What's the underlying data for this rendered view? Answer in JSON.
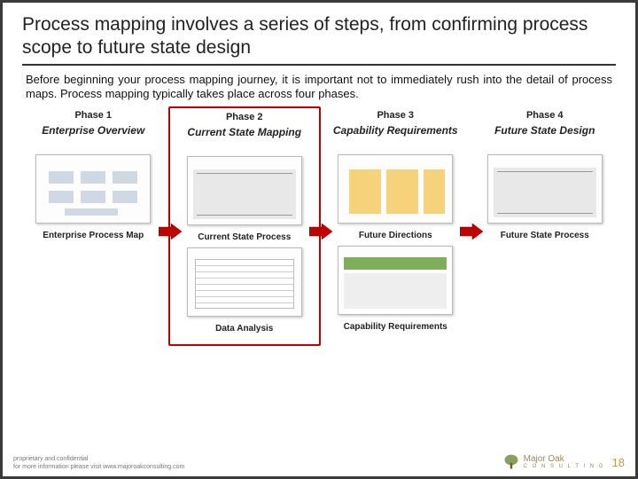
{
  "title": "Process mapping involves a series of steps, from confirming process scope to future state design",
  "intro": "Before beginning your process mapping journey, it is important not to immediately rush into the detail of process maps. Process mapping typically takes place across four phases.",
  "phases": [
    {
      "label": "Phase 1",
      "title": "Enterprise Overview",
      "items": [
        {
          "caption": "Enterprise Process Map"
        }
      ]
    },
    {
      "label": "Phase 2",
      "title": "Current State Mapping",
      "items": [
        {
          "caption": "Current State Process"
        },
        {
          "caption": "Data Analysis"
        }
      ]
    },
    {
      "label": "Phase 3",
      "title": "Capability Requirements",
      "items": [
        {
          "caption": "Future Directions"
        },
        {
          "caption": "Capability Requirements"
        }
      ]
    },
    {
      "label": "Phase 4",
      "title": "Future State Design",
      "items": [
        {
          "caption": "Future State Process"
        }
      ]
    }
  ],
  "footer": {
    "line1": "proprietary and confidential",
    "line2": "for more information please visit www.majoroakconsulting.com",
    "brand_top": "Major Oak",
    "brand_bottom": "C O N S U L T I N G",
    "page": "18"
  },
  "colors": {
    "highlight_border": "#c00000",
    "arrow_fill": "#c00000"
  }
}
